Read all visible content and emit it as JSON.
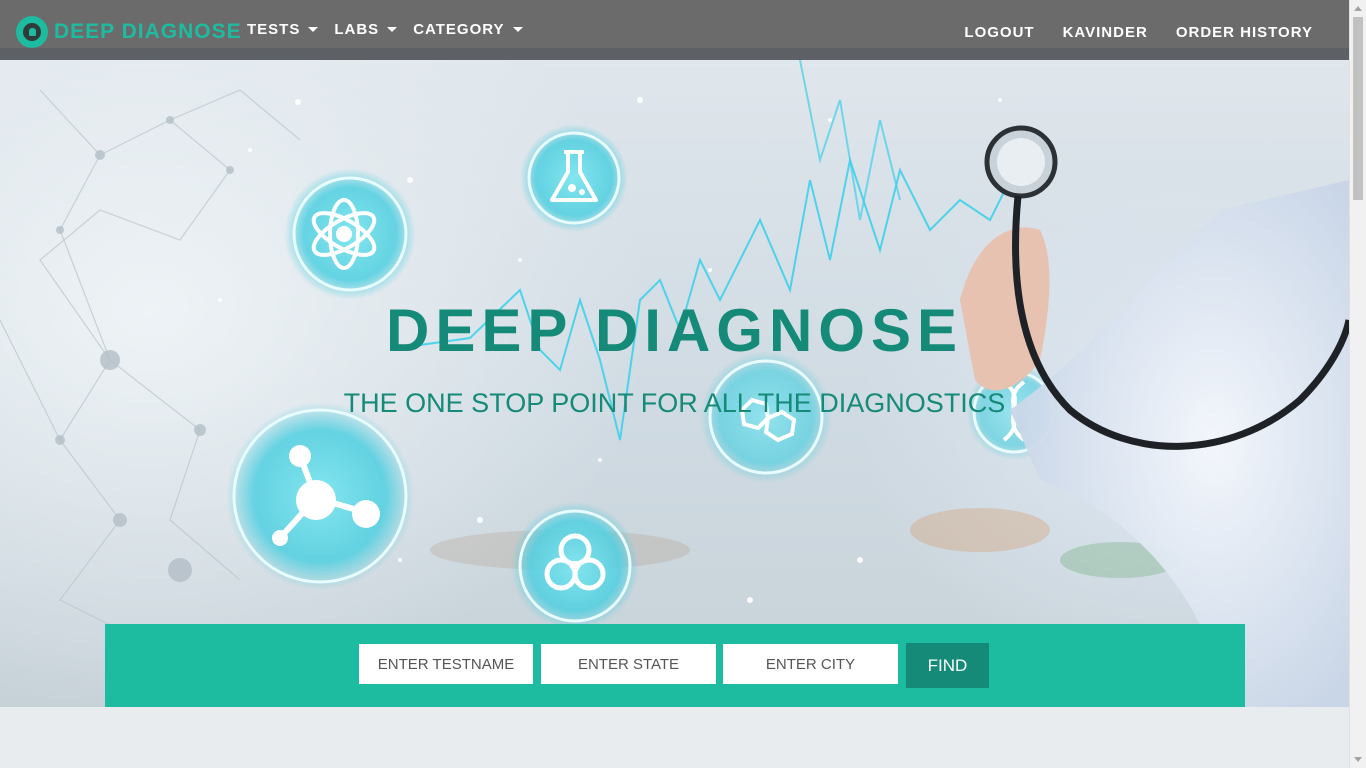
{
  "navbar": {
    "brand": "DEEP DIAGNOSE",
    "menu": [
      {
        "label": "TESTS"
      },
      {
        "label": "LABS"
      },
      {
        "label": "CATEGORY"
      }
    ],
    "right_links": [
      {
        "label": "LOGOUT"
      },
      {
        "label": "KAVINDER"
      },
      {
        "label": "ORDER HISTORY"
      }
    ]
  },
  "hero": {
    "title": "DEEP DIAGNOSE",
    "subtitle": "THE ONE STOP POINT FOR ALL THE DIAGNOSTICS"
  },
  "search": {
    "testname_placeholder": "ENTER TESTNAME",
    "state_placeholder": "ENTER STATE",
    "city_placeholder": "ENTER CITY",
    "testname_value": "",
    "state_value": "",
    "city_value": "",
    "find_label": "FIND"
  },
  "icons": {
    "brand_logo": "brand-logo-icon",
    "hero_icons": [
      "atom-icon",
      "flask-icon",
      "molecule-icon",
      "chemical-structure-icon",
      "dna-icon",
      "biohazard-icon",
      "stethoscope-icon",
      "heartbeat-line-icon"
    ]
  },
  "colors": {
    "accent": "#1dbb9f",
    "accent_dark": "#158a78",
    "navbar": "#6b6b6b",
    "hero_icon_glow": "#5fd8e6"
  }
}
